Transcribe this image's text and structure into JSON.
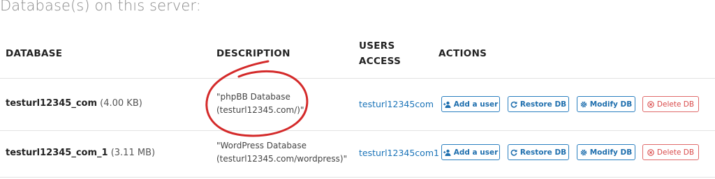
{
  "page_title": "Database(s) on this server:",
  "table": {
    "headers": {
      "database": "DATABASE",
      "description": "DESCRIPTION",
      "users_line1": "USERS",
      "users_line2": "ACCESS",
      "actions": "ACTIONS"
    },
    "rows": [
      {
        "name": "testurl12345_com",
        "size": "(4.00 KB)",
        "description_line1": "\"phpBB Database",
        "description_line2": "(testurl12345.com/)\"",
        "users": "testurl12345com"
      },
      {
        "name": "testurl12345_com_1",
        "size": "(3.11 MB)",
        "description_line1": "\"WordPress Database",
        "description_line2": "(testurl12345.com/wordpress)\"",
        "users": "testurl12345com1"
      }
    ]
  },
  "actions": {
    "add_user": "Add a user",
    "restore": "Restore DB",
    "modify": "Modify DB",
    "delete": "Delete DB"
  },
  "icons": {
    "add_user": "user-plus-icon",
    "restore": "refresh-icon",
    "modify": "gear-icon",
    "delete": "cancel-circle-icon"
  },
  "colors": {
    "primary": "#1f6fae",
    "danger": "#d94a4a",
    "annotation": "#d42a2a"
  }
}
